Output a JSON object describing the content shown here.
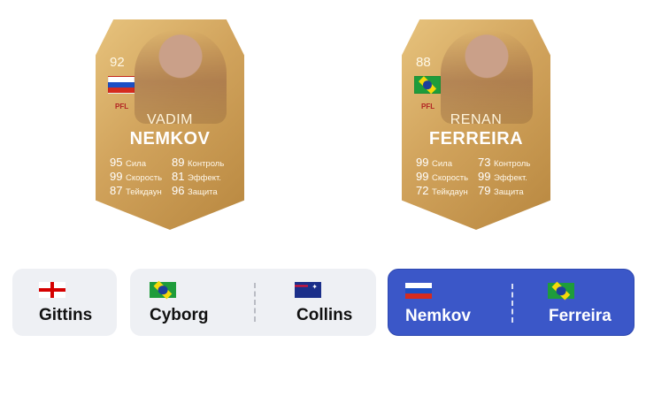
{
  "cards": [
    {
      "rating": "92",
      "flag": "russia-flag",
      "league_logo": "PFL",
      "first_name": "VADIM",
      "last_name": "NEMKOV",
      "stats": [
        {
          "v": "95",
          "label": "Сила"
        },
        {
          "v": "89",
          "label": "Контроль"
        },
        {
          "v": "99",
          "label": "Скорость"
        },
        {
          "v": "81",
          "label": "Эффект."
        },
        {
          "v": "87",
          "label": "Тейкдаун"
        },
        {
          "v": "96",
          "label": "Защита"
        }
      ]
    },
    {
      "rating": "88",
      "flag": "brazil-flag",
      "league_logo": "PFL",
      "first_name": "RENAN",
      "last_name": "FERREIRA",
      "stats": [
        {
          "v": "99",
          "label": "Сила"
        },
        {
          "v": "73",
          "label": "Контроль"
        },
        {
          "v": "99",
          "label": "Скорость"
        },
        {
          "v": "99",
          "label": "Эффект."
        },
        {
          "v": "72",
          "label": "Тейкдаун"
        },
        {
          "v": "79",
          "label": "Защита"
        }
      ]
    }
  ],
  "matchups": [
    {
      "fighters": [
        {
          "name": "Gittins",
          "flag": "england-flag"
        }
      ],
      "selected": false
    },
    {
      "fighters": [
        {
          "name": "Cyborg",
          "flag": "brazil-flag"
        },
        {
          "name": "Collins",
          "flag": "australia-flag"
        }
      ],
      "selected": false
    },
    {
      "fighters": [
        {
          "name": "Nemkov",
          "flag": "russia-flag"
        },
        {
          "name": "Ferreira",
          "flag": "brazil-flag"
        }
      ],
      "selected": true
    }
  ],
  "colors": {
    "card_gold": "#d1a35c",
    "selected_pill": "#3b57c8",
    "pill_bg": "#eef0f4"
  }
}
